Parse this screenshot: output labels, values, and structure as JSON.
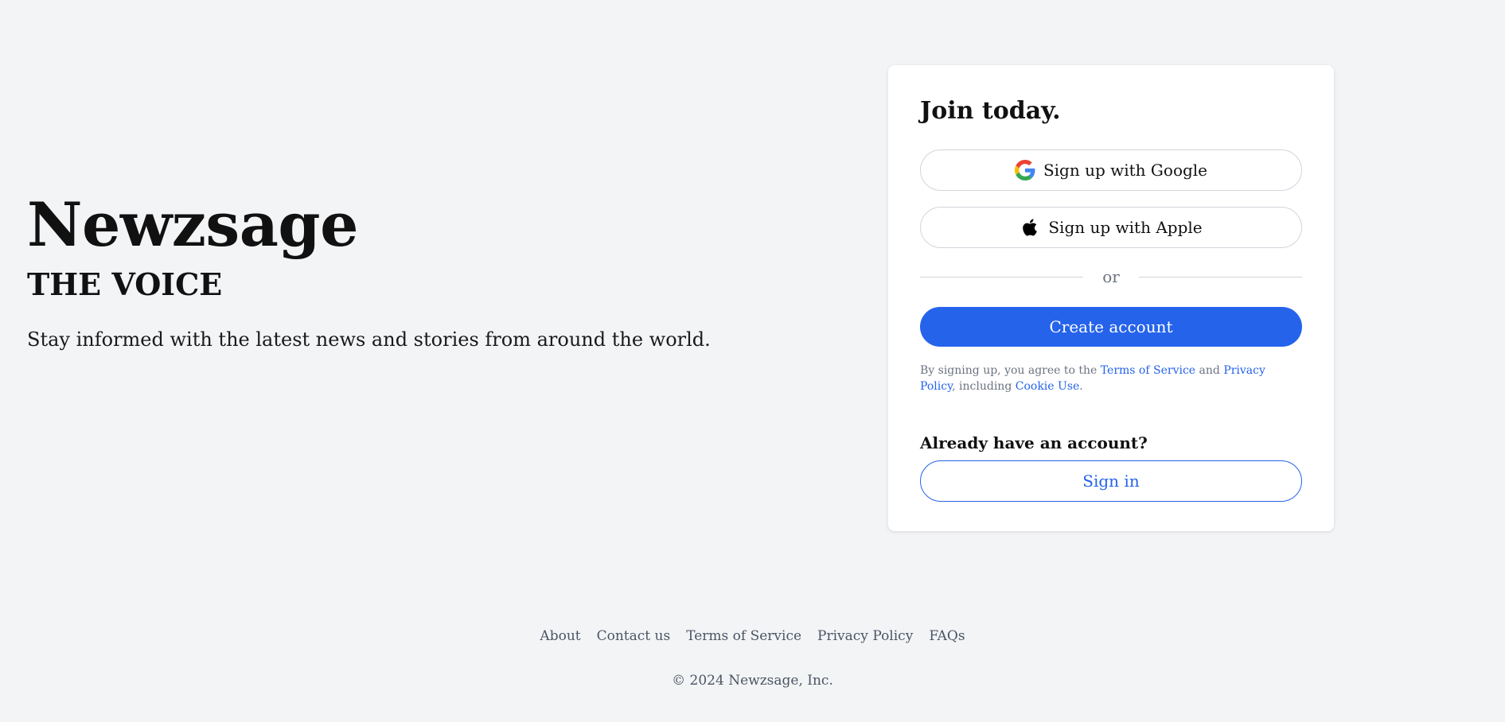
{
  "hero": {
    "brand": "Newzsage",
    "tagline": "THE VOICE",
    "lead": "Stay informed with the latest news and stories from around the world."
  },
  "signup": {
    "title": "Join today.",
    "google_label": "Sign up with Google",
    "google_icon": "google-icon",
    "apple_label": "Sign up with Apple",
    "apple_icon": "apple-icon",
    "divider_text": "or",
    "create_label": "Create account",
    "terms": {
      "prefix": "By signing up, you agree to the",
      "tos_link": "Terms of Service",
      "and": "and",
      "privacy_link": "Privacy Policy",
      "including": ", including",
      "cookie_link": "Cookie Use",
      "suffix": "."
    },
    "have_account": "Already have an account?",
    "signin_label": "Sign in"
  },
  "footer": {
    "links": [
      "About",
      "Contact us",
      "Terms of Service",
      "Privacy Policy",
      "FAQs"
    ],
    "copyright": "© 2024 Newzsage, Inc."
  },
  "colors": {
    "background": "#f3f4f6",
    "primary": "#2563eb",
    "card": "#ffffff",
    "muted_text": "#6b7280"
  }
}
